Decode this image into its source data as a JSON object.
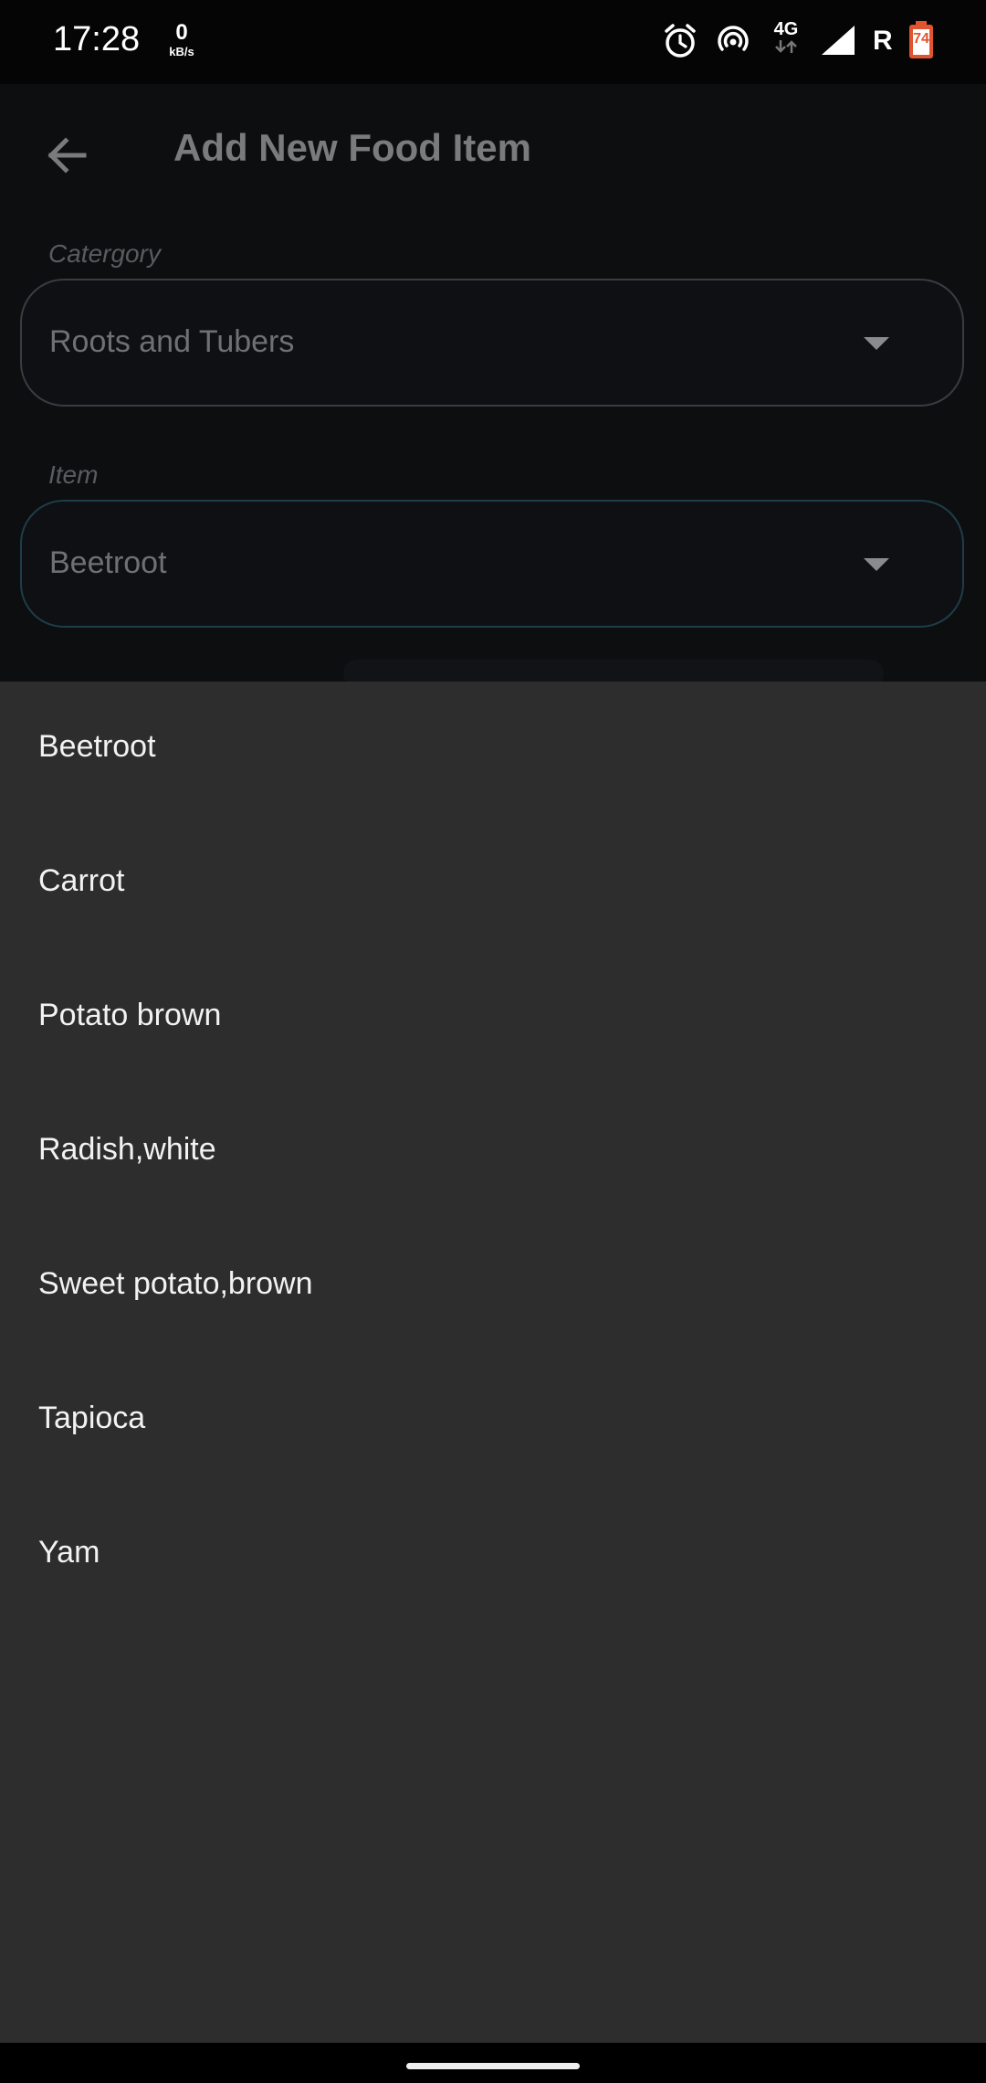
{
  "status_bar": {
    "time": "17:28",
    "net_speed_value": "0",
    "net_speed_unit": "kB/s",
    "network_type": "4G",
    "roaming": "R",
    "battery_level": "74",
    "icons": [
      "alarm-icon",
      "hotspot-icon",
      "data-arrows-icon",
      "signal-icon",
      "battery-icon"
    ]
  },
  "header": {
    "title": "Add New Food Item",
    "back_icon": "arrow-left-icon"
  },
  "form": {
    "category_label": "Catergory",
    "category_value": "Roots and Tubers",
    "item_label": "Item",
    "item_value": "Beetroot"
  },
  "dropdown": {
    "items": [
      "Beetroot",
      "Carrot",
      "Potato brown",
      "Radish,white",
      "Sweet potato,brown",
      "Tapioca",
      "Yam"
    ]
  },
  "colors": {
    "menu_background": "#2d2d2d",
    "app_background": "#0d0e10",
    "battery_accent": "#e0552f",
    "focus_border": "#1f3d48"
  }
}
